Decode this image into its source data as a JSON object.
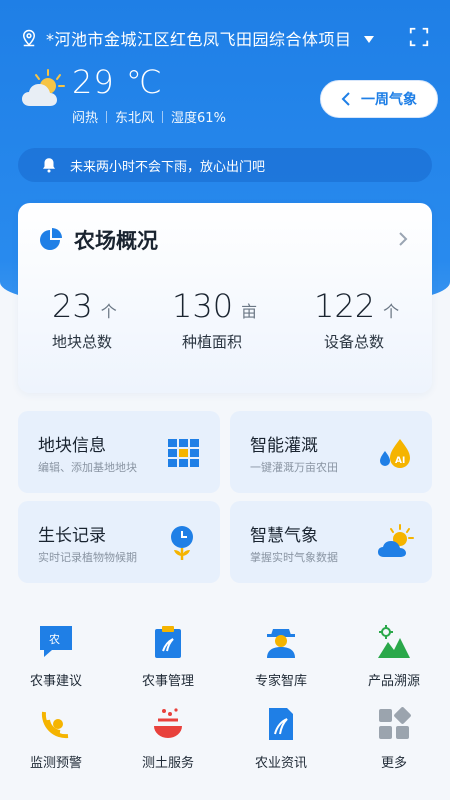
{
  "header": {
    "location": "*河池市金城江区红色凤飞田园综合体项目",
    "pin_icon": "location-pin-icon",
    "scan_icon": "fullscreen-icon"
  },
  "weather": {
    "temperature": "29 ℃",
    "condition": "闷热",
    "wind": "东北风",
    "humidity": "湿度61%",
    "week_button": "一周气象"
  },
  "notice": {
    "text": "未来两小时不会下雨，放心出门吧"
  },
  "overview": {
    "title": "农场概况",
    "stats": [
      {
        "value": "23",
        "unit": "个",
        "label": "地块总数"
      },
      {
        "value": "130",
        "unit": "亩",
        "label": "种植面积"
      },
      {
        "value": "122",
        "unit": "个",
        "label": "设备总数"
      }
    ]
  },
  "cards": [
    {
      "title": "地块信息",
      "subtitle": "编辑、添加基地地块",
      "icon": "grid-blocks-icon"
    },
    {
      "title": "智能灌溉",
      "subtitle": "一键灌溉万亩农田",
      "icon": "water-drops-ai-icon"
    },
    {
      "title": "生长记录",
      "subtitle": "实时记录植物物候期",
      "icon": "plant-clock-icon"
    },
    {
      "title": "智慧气象",
      "subtitle": "掌握实时气象数据",
      "icon": "sun-cloud-icon"
    }
  ],
  "grid": [
    {
      "label": "农事建议",
      "badge": "农"
    },
    {
      "label": "农事管理"
    },
    {
      "label": "专家智库"
    },
    {
      "label": "产品溯源"
    },
    {
      "label": "监测预警"
    },
    {
      "label": "测土服务"
    },
    {
      "label": "农业资讯"
    },
    {
      "label": "更多"
    }
  ],
  "colors": {
    "primary": "#1f7fe6",
    "accent_yellow": "#f5b400",
    "accent_red": "#e8413c",
    "card_bg": "#e7f0fc"
  }
}
